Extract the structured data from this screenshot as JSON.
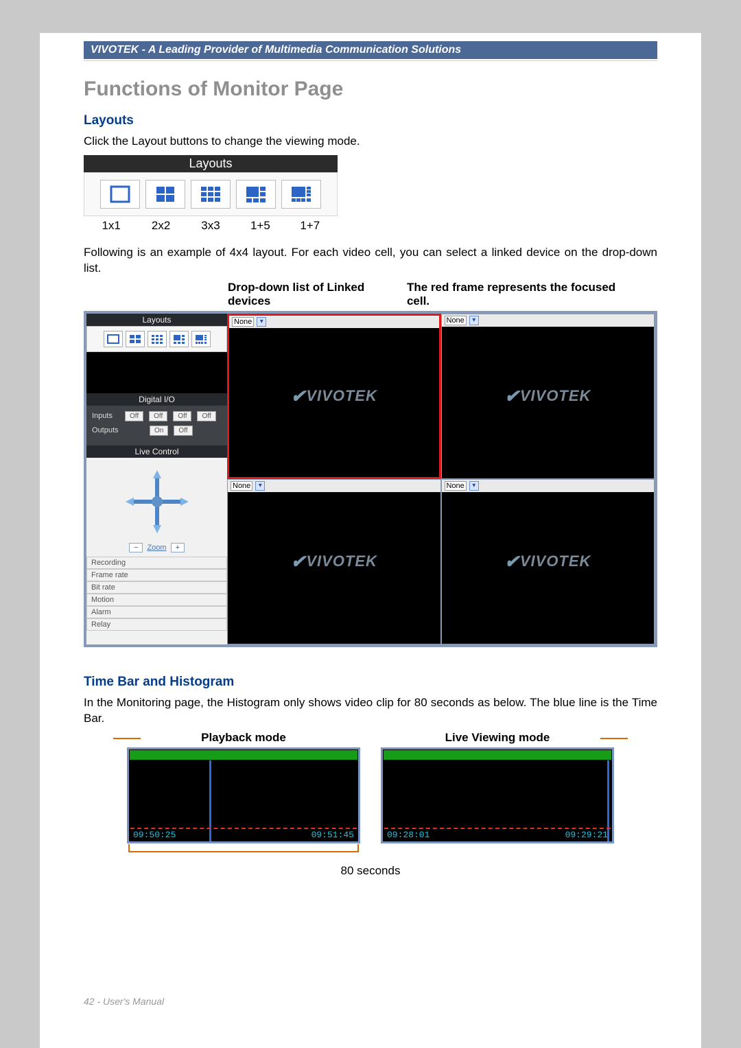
{
  "header": "VIVOTEK - A Leading Provider of Multimedia Communication Solutions",
  "title": "Functions of Monitor Page",
  "section_layouts": {
    "heading": "Layouts",
    "intro": "Click the Layout buttons to change the viewing mode.",
    "bar_title": "Layouts",
    "captions": [
      "1x1",
      "2x2",
      "3x3",
      "1+5",
      "1+7"
    ]
  },
  "example_text": "Following is an example of 4x4 layout. For each video cell, you can select a linked device on the drop-down list.",
  "fig_labels": {
    "dropdown": "Drop-down list of Linked devices",
    "redframe": "The red frame represents the focused cell."
  },
  "sidebar": {
    "title": "Layouts",
    "digio_title": "Digital I/O",
    "inputs_label": "Inputs",
    "outputs_label": "Outputs",
    "off": "Off",
    "on": "On",
    "live_title": "Live Control",
    "zoom": "Zoom",
    "stats": [
      "Recording",
      "Frame rate",
      "Bit rate",
      "Motion",
      "Alarm",
      "Relay"
    ]
  },
  "cells": {
    "select_value": "None",
    "logo": "VIVOTEK"
  },
  "section_timebar": {
    "heading": "Time Bar and Histogram",
    "text": "In the Monitoring page, the Histogram only shows video clip for 80 seconds as below. The blue line is the Time Bar.",
    "playback_label": "Playback mode",
    "live_label": "Live Viewing mode",
    "playback_times": [
      "09:50:25",
      "09:51:45"
    ],
    "live_times": [
      "09:28:01",
      "09:29:21"
    ],
    "duration": "80 seconds"
  },
  "footer": "42 - User's Manual"
}
